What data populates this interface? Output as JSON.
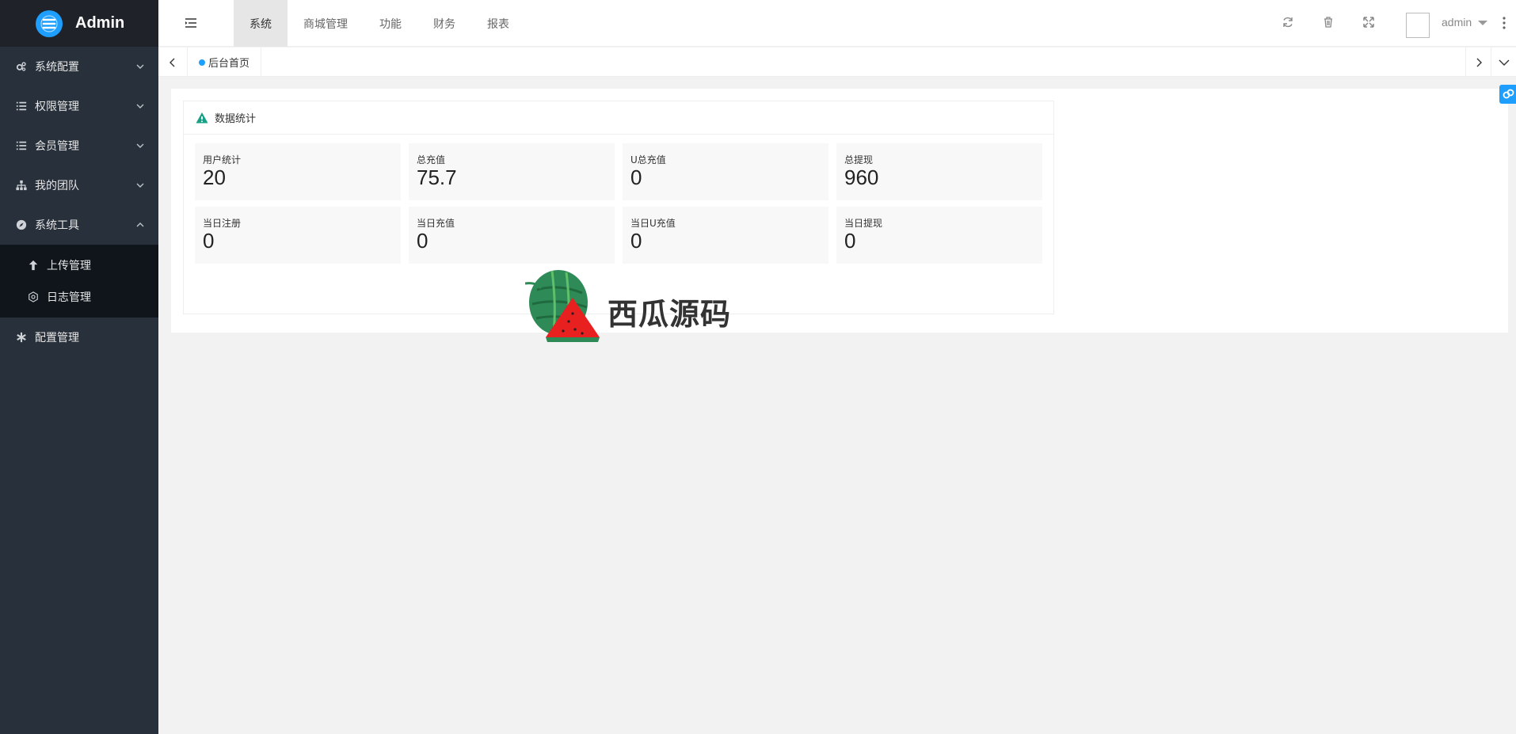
{
  "app": {
    "title": "Admin"
  },
  "sidebar": {
    "items": [
      {
        "label": "系统配置",
        "icon": "gears-icon",
        "expanded": false
      },
      {
        "label": "权限管理",
        "icon": "list-icon",
        "expanded": false
      },
      {
        "label": "会员管理",
        "icon": "list-icon",
        "expanded": false
      },
      {
        "label": "我的团队",
        "icon": "sitemap-icon",
        "expanded": false
      },
      {
        "label": "系统工具",
        "icon": "compass-icon",
        "expanded": true,
        "children": [
          {
            "label": "上传管理",
            "icon": "arrow-up-icon"
          },
          {
            "label": "日志管理",
            "icon": "log-icon"
          }
        ]
      },
      {
        "label": "配置管理",
        "icon": "asterisk-icon",
        "expanded": false
      }
    ]
  },
  "header": {
    "tabs": [
      {
        "label": "系统",
        "active": true
      },
      {
        "label": "商城管理",
        "active": false
      },
      {
        "label": "功能",
        "active": false
      },
      {
        "label": "财务",
        "active": false
      },
      {
        "label": "报表",
        "active": false
      }
    ],
    "username": "admin"
  },
  "tabbar": {
    "page_tab": "后台首页"
  },
  "dashboard": {
    "title": "数据统计",
    "stats": [
      {
        "label": "用户统计",
        "value": "20"
      },
      {
        "label": "总充值",
        "value": "75.7"
      },
      {
        "label": "U总充值",
        "value": "0"
      },
      {
        "label": "总提现",
        "value": "960"
      },
      {
        "label": "当日注册",
        "value": "0"
      },
      {
        "label": "当日充值",
        "value": "0"
      },
      {
        "label": "当日U充值",
        "value": "0"
      },
      {
        "label": "当日提现",
        "value": "0"
      }
    ]
  },
  "watermark": {
    "text": "西瓜源码"
  },
  "colors": {
    "sidebar_bg": "#28303b",
    "logo_bg": "#20222a",
    "submenu_bg": "#10151c",
    "accent": "#1e9fff",
    "warning_icon": "#16a086"
  }
}
